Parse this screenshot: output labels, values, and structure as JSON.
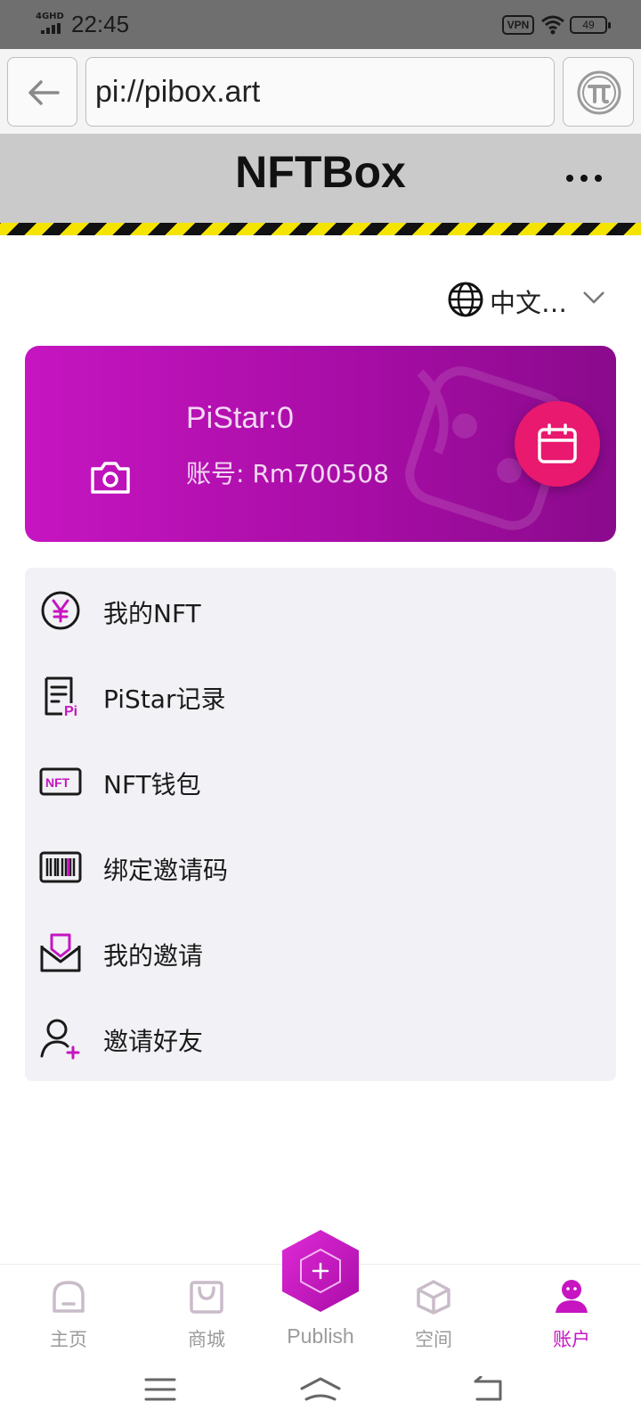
{
  "status_bar": {
    "network": "4GHD",
    "time": "22:45",
    "vpn": "VPN",
    "battery": "49"
  },
  "browser": {
    "url": "pi://pibox.art"
  },
  "header": {
    "title": "NFTBox"
  },
  "language": {
    "selected": "中文…"
  },
  "profile": {
    "pistar": "PiStar:0",
    "account": "账号: Rm700508"
  },
  "menu": {
    "items": [
      {
        "label": "我的NFT",
        "icon": "yen-coin-icon"
      },
      {
        "label": "PiStar记录",
        "icon": "pi-record-icon"
      },
      {
        "label": "NFT钱包",
        "icon": "nft-wallet-icon"
      },
      {
        "label": "绑定邀请码",
        "icon": "barcode-icon"
      },
      {
        "label": "我的邀请",
        "icon": "invite-envelope-icon"
      },
      {
        "label": "邀请好友",
        "icon": "add-friend-icon"
      }
    ]
  },
  "bottom_nav": {
    "tabs": [
      {
        "label": "主页",
        "icon": "home-icon"
      },
      {
        "label": "商城",
        "icon": "shopping-bag-icon"
      },
      {
        "label": "空间",
        "icon": "cube-icon"
      },
      {
        "label": "账户",
        "icon": "account-icon",
        "active": true
      }
    ],
    "publish_label": "Publish"
  },
  "colors": {
    "accent": "#c615c1",
    "checkin": "#e8196e",
    "nav_inactive": "#9b9b9b"
  }
}
